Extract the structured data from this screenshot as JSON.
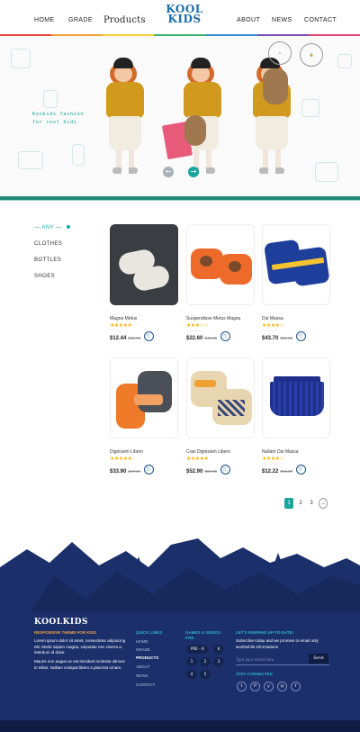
{
  "nav": {
    "left": [
      "HOME",
      "GRADE",
      "Products"
    ],
    "right": [
      "ABOUT",
      "NEWS",
      "CONTACT"
    ],
    "logo_line1": "KOOL",
    "logo_line2": "KIDS",
    "strip_colors": [
      "#e8443a",
      "#f2a23a",
      "#f6d23a",
      "#3bb273",
      "#2f8fd0",
      "#7a4fb3",
      "#e0457b"
    ]
  },
  "hero": {
    "tagline_1": "Kookids fashion",
    "tagline_2": "for cool kids",
    "prev_icon": "arrow-left-icon",
    "next_icon": "arrow-right-icon",
    "accent": "#1aa59c"
  },
  "sidebar": {
    "any": "— ANY —",
    "categories": [
      "CLOTHES",
      "BOTTLES",
      "SHOES"
    ]
  },
  "products": [
    {
      "name": "Magna Metus",
      "price": "$12.44",
      "old": "$41.09",
      "stars": "★★★★★"
    },
    {
      "name": "Suspendisse Metus Magna",
      "price": "$22.60",
      "old": "$41.55",
      "stars": "★★★☆☆"
    },
    {
      "name": "Dui Massa",
      "price": "$43.70",
      "old": "$50.80",
      "stars": "★★★★☆"
    },
    {
      "name": "Dignissim Libero",
      "price": "$33.90",
      "old": "$47.60",
      "stars": "★★★★★"
    },
    {
      "name": "Cras Dignissim Libero",
      "price": "$52.90",
      "old": "$84.99",
      "stars": "★★★★★"
    },
    {
      "name": "Nullam Dui Massa",
      "price": "$12.22",
      "old": "$41.00",
      "stars": "★★★★☆"
    }
  ],
  "pagination": {
    "pages": [
      "1",
      "2",
      "3"
    ],
    "next": "→"
  },
  "footer": {
    "logo": "KOOLKIDS",
    "sub": "RESPONSIVE THEME FOR KIDS",
    "p1": "Lorem ipsum dolor sit amet, consectetur adipiscing elit. Morbi sapien magna, vulputate nec viverra a, interdum id dolor.",
    "p2": "Mauris non augue ac est tincidunt molestie ultrices in tellus. Nullam volutpat libero a placerat ornare.",
    "quick_links_title": "QUICK LINKS",
    "quick_links": [
      "HOME",
      "GRADE",
      "PRODUCTS",
      "ABOUT",
      "NEWS",
      "CONTACT"
    ],
    "games_title_1": "GAMES & VIDEOS",
    "games_title_2": "FOR",
    "chips": [
      "PRE – K",
      "K",
      "1",
      "2",
      "3",
      "4",
      "5"
    ],
    "newsletter_title": "LET'S KEEPING UP-TO-DATE!",
    "newsletter_text": "Subscribe today and we promise to email only worthwhile informations",
    "email_placeholder": "Type your email here",
    "send": "Send",
    "connected_title": "STAY CONNECTED",
    "social": [
      "t",
      "P",
      "y",
      "◎",
      "f"
    ]
  }
}
